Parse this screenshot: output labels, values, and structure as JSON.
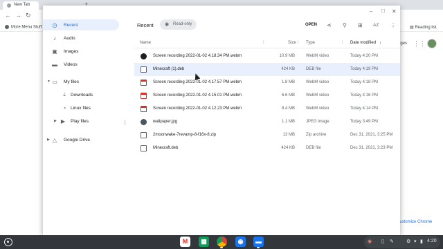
{
  "chrome": {
    "tab_title": "New Tab",
    "new_tab_symbol": "+",
    "bookmark": "More Menu Stuff",
    "reading_list": "Reading list",
    "ntp_images": "ages",
    "customize": "Customize Chrome"
  },
  "window_controls": {
    "minimize": "–",
    "maximize": "□",
    "close": "✕"
  },
  "sidebar": {
    "items": [
      {
        "label": "Recent",
        "icon": "clock-icon",
        "active": true
      },
      {
        "label": "Audio",
        "icon": "audio-icon"
      },
      {
        "label": "Images",
        "icon": "image-icon"
      },
      {
        "label": "Videos",
        "icon": "video-icon"
      },
      {
        "label": "My files",
        "icon": "computer-icon"
      },
      {
        "label": "Downloads",
        "icon": "download-icon"
      },
      {
        "label": "Linux files",
        "icon": "linux-icon"
      },
      {
        "label": "Play files",
        "icon": "play-icon"
      },
      {
        "label": "Google Drive",
        "icon": "drive-icon"
      }
    ]
  },
  "toolbar": {
    "title": "Recent",
    "chip": "Read-only",
    "open": "OPEN",
    "share_icon": "share-icon",
    "search_icon": "search-icon",
    "grid_icon": "grid-view-icon",
    "sort_icon": "sort-az-icon",
    "more_icon": "more-vert-icon"
  },
  "table": {
    "headers": {
      "name": "Name",
      "size": "Size",
      "type": "Type",
      "date": "Date modified"
    },
    "rows": [
      {
        "name": "Screen recording 2022-01-02 4.18.34 PM.webm",
        "size": "10.9 MB",
        "type": "WebM video",
        "date": "Today 4:20 PM",
        "icon": "recording-thumbnail"
      },
      {
        "name": "Minecraft (1).deb",
        "size": "424 KB",
        "type": "DEB file",
        "date": "Today 4:19 PM",
        "icon": "file-icon",
        "selected": true
      },
      {
        "name": "Screen recording 2022-01-02 4.17.57 PM.webm",
        "size": "1.8 MB",
        "type": "WebM video",
        "date": "Today 4:18 PM",
        "icon": "video-file-icon"
      },
      {
        "name": "Screen recording 2022-01-02 4.15.01 PM.webm",
        "size": "6.6 MB",
        "type": "WebM video",
        "date": "Today 4:16 PM",
        "icon": "video-file-icon"
      },
      {
        "name": "Screen recording 2022-01-02 4.12.23 PM.webm",
        "size": "8.4 MB",
        "type": "WebM video",
        "date": "Today 4:14 PM",
        "icon": "video-file-icon"
      },
      {
        "name": "wallpaper.jpg",
        "size": "1.1 MB",
        "type": "JPEG image",
        "date": "Today 3:49 PM",
        "icon": "image-thumbnail"
      },
      {
        "name": "2moonwake-7revamp-8-f16x-8.zip",
        "size": "13 MB",
        "type": "Zip archive",
        "date": "Dec 31, 2021, 3:25 PM",
        "icon": "zip-file-icon"
      },
      {
        "name": "Minecraft.deb",
        "size": "424 KB",
        "type": "DEB file",
        "date": "Dec 31, 2021, 3:23 PM",
        "icon": "file-icon"
      }
    ]
  },
  "shelf": {
    "apps": [
      "Gmail",
      "Sheets",
      "Chrome",
      "Camera",
      "Files"
    ],
    "clock": "4:20"
  }
}
